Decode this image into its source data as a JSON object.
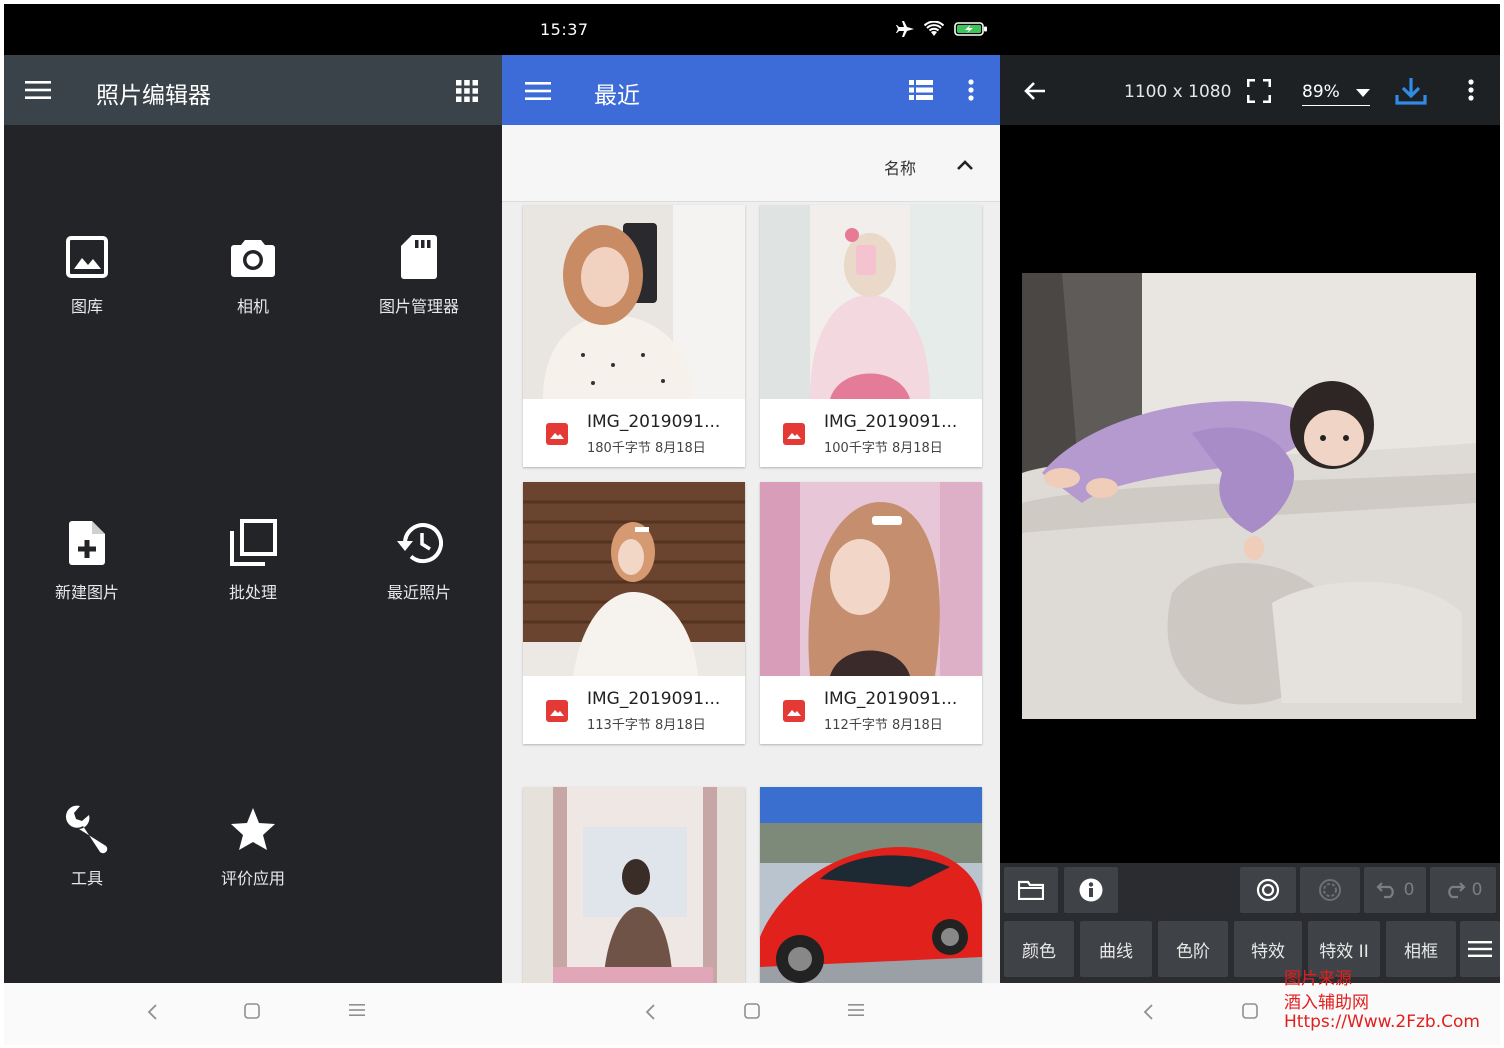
{
  "status_bar": {
    "time": "15:37"
  },
  "panel_editor_home": {
    "title": "照片编辑器",
    "tiles": [
      {
        "label": "图库",
        "icon": "image-icon"
      },
      {
        "label": "相机",
        "icon": "camera-icon"
      },
      {
        "label": "图片管理器",
        "icon": "sd-card-icon"
      },
      {
        "label": "新建图片",
        "icon": "new-file-icon"
      },
      {
        "label": "批处理",
        "icon": "batch-icon"
      },
      {
        "label": "最近照片",
        "icon": "history-icon"
      },
      {
        "label": "工具",
        "icon": "wrench-icon"
      },
      {
        "label": "评价应用",
        "icon": "star-icon"
      }
    ]
  },
  "panel_recent": {
    "title": "最近",
    "sort_label": "名称",
    "files": [
      {
        "name": "IMG_2019091...",
        "meta": "180千字节 8月18日"
      },
      {
        "name": "IMG_2019091...",
        "meta": "100千字节 8月18日"
      },
      {
        "name": "IMG_2019091...",
        "meta": "113千字节 8月18日"
      },
      {
        "name": "IMG_2019091...",
        "meta": "112千字节 8月18日"
      }
    ]
  },
  "panel_viewer": {
    "dimensions": "1100 x 1080",
    "zoom": "89%",
    "undo_count": "0",
    "redo_count": "0",
    "tools": [
      "颜色",
      "曲线",
      "色阶",
      "特效",
      "特效 II",
      "相框"
    ]
  },
  "watermark": {
    "line1": "图片来源",
    "line2": "酒入辅助网",
    "line3": "Https://Www.2Fzb.Com"
  },
  "colors": {
    "editor_bg": "#222427",
    "editor_bar": "#3a4349",
    "recent_bar": "#3d6cd8",
    "file_icon": "#e53935",
    "download": "#2f8be6"
  }
}
